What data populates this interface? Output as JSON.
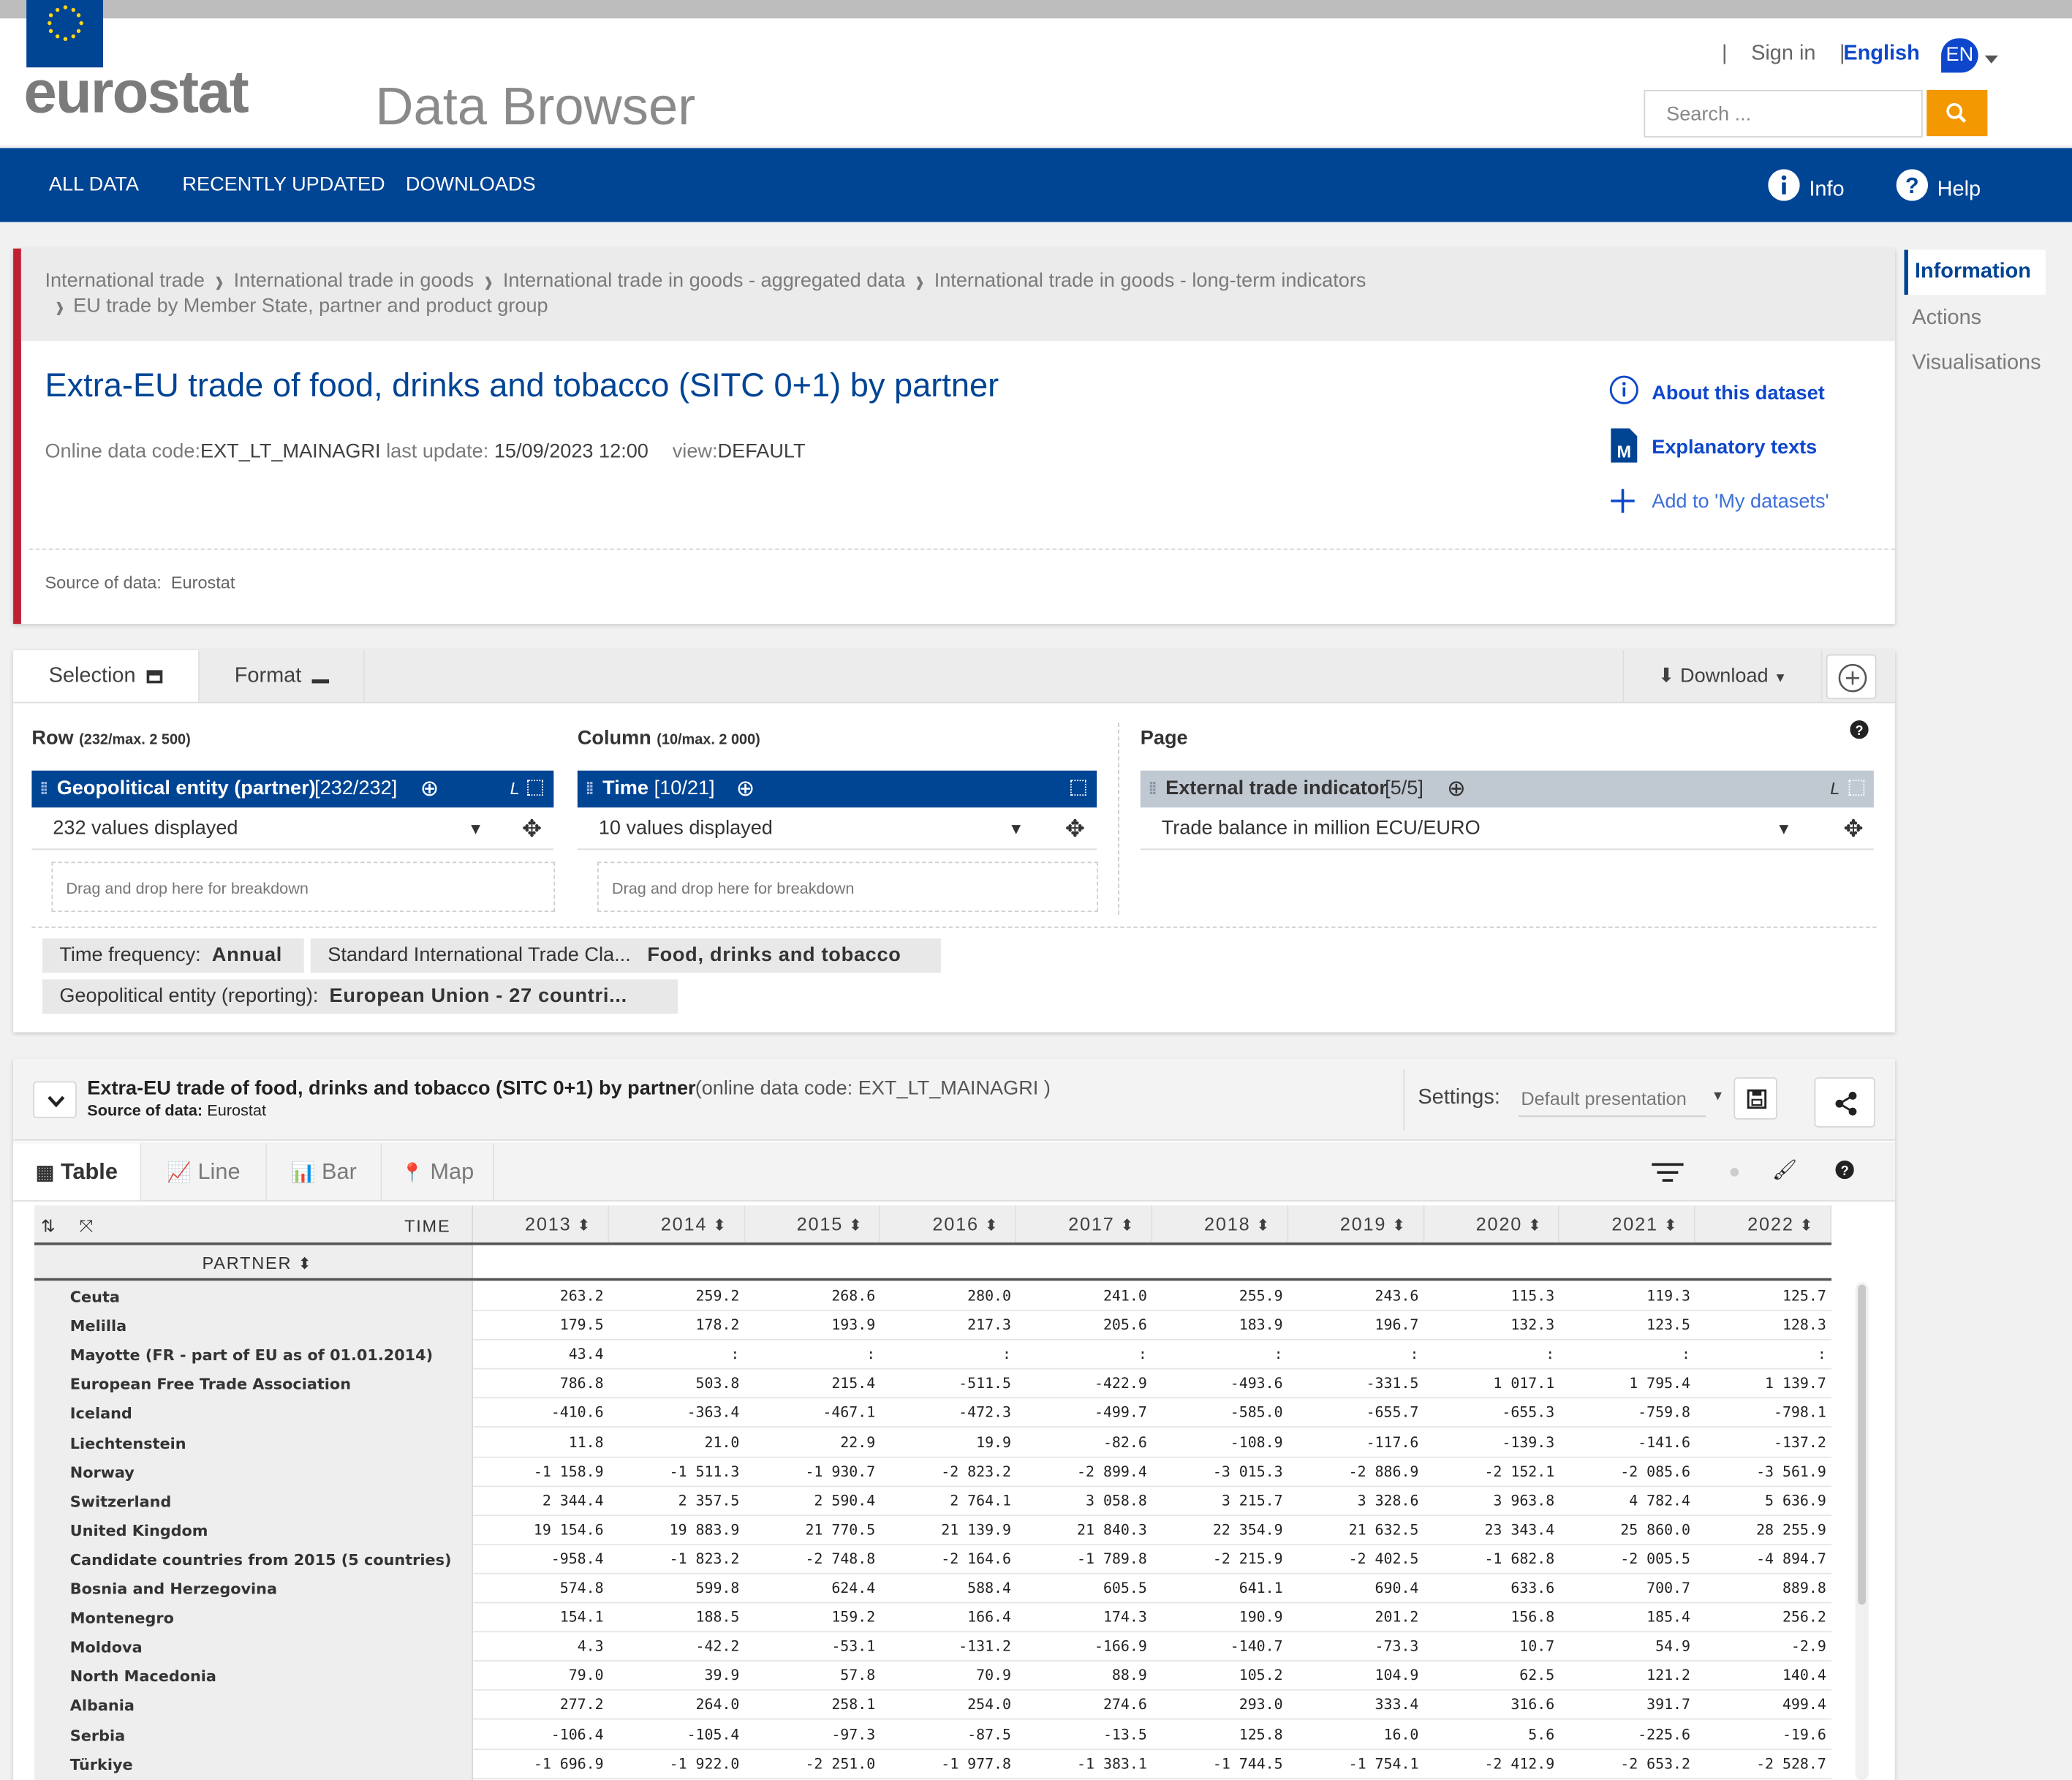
{
  "header": {
    "logo": "eurostat",
    "app_title": "Data Browser",
    "sign_in": "Sign in",
    "language": "English",
    "lang_code": "EN",
    "search_placeholder": "Search ...",
    "colors": {
      "brand": "#004494",
      "accent": "#f39800"
    }
  },
  "nav": {
    "items": [
      "ALL DATA",
      "RECENTLY UPDATED",
      "DOWNLOADS"
    ],
    "info": "Info",
    "help": "Help"
  },
  "breadcrumb": {
    "line1": [
      "International trade",
      "International trade in goods",
      "International trade in goods - aggregated data",
      "International trade in goods - long-term indicators"
    ],
    "line2": "EU trade by Member State, partner and product group"
  },
  "dataset": {
    "title": "Extra-EU trade of food, drinks and tobacco (SITC 0+1) by partner",
    "code_label": "Online data code:",
    "code": "EXT_LT_MAINAGRI",
    "update_label": "last update:",
    "update": "15/09/2023 12:00",
    "view_label": "view:",
    "view": "DEFAULT",
    "source_label": "Source of data:",
    "source": "Eurostat"
  },
  "dataset_links": {
    "about": "About this dataset",
    "explanatory": "Explanatory texts",
    "add": "Add to 'My datasets'"
  },
  "side_menu": {
    "items": [
      "Information",
      "Actions",
      "Visualisations"
    ],
    "active": "Information"
  },
  "selection": {
    "tab_selection": "Selection",
    "tab_format": "Format",
    "download": "Download",
    "row_label": "Row",
    "row_count": "(232/max. 2 500)",
    "col_label": "Column",
    "col_count": "(10/max. 2 000)",
    "page_label": "Page",
    "row_dim": "Geopolitical entity (partner)",
    "row_dim_count": "[232/232]",
    "row_values": "232 values displayed",
    "col_dim": "Time",
    "col_dim_count": "[10/21]",
    "col_values": "10 values displayed",
    "page_dim": "External trade indicator",
    "page_dim_count": "[5/5]",
    "page_value": "Trade balance in million ECU/EURO",
    "drag_hint": "Drag and drop here for breakdown",
    "l_marker": "L",
    "filters": [
      {
        "label": "Time frequency:",
        "value": "Annual"
      },
      {
        "label": "Standard International Trade Cla...",
        "value": "Food, drinks and tobacco"
      },
      {
        "label": "Geopolitical entity (reporting):",
        "value": "European Union - 27 countri..."
      }
    ]
  },
  "table_panel": {
    "title": "Extra-EU trade of food, drinks and tobacco (SITC 0+1) by partner",
    "code_note": "(online data code: EXT_LT_MAINAGRI )",
    "source_label": "Source of data:",
    "source": "Eurostat",
    "settings_label": "Settings:",
    "settings_value": "Default presentation",
    "view_tabs": [
      "Table",
      "Line",
      "Bar",
      "Map"
    ],
    "time_header": "TIME",
    "partner_header": "PARTNER",
    "years": [
      "2013",
      "2014",
      "2015",
      "2016",
      "2017",
      "2018",
      "2019",
      "2020",
      "2021",
      "2022"
    ],
    "rows": [
      {
        "partner": "Ceuta",
        "values": [
          "263.2",
          "259.2",
          "268.6",
          "280.0",
          "241.0",
          "255.9",
          "243.6",
          "115.3",
          "119.3",
          "125.7"
        ]
      },
      {
        "partner": "Melilla",
        "values": [
          "179.5",
          "178.2",
          "193.9",
          "217.3",
          "205.6",
          "183.9",
          "196.7",
          "132.3",
          "123.5",
          "128.3"
        ]
      },
      {
        "partner": "Mayotte (FR - part of EU as of 01.01.2014)",
        "values": [
          "43.4",
          ":",
          ":",
          ":",
          ":",
          ":",
          ":",
          ":",
          ":",
          ":"
        ]
      },
      {
        "partner": "European Free Trade Association",
        "values": [
          "786.8",
          "503.8",
          "215.4",
          "-511.5",
          "-422.9",
          "-493.6",
          "-331.5",
          "1 017.1",
          "1 795.4",
          "1 139.7"
        ]
      },
      {
        "partner": "Iceland",
        "values": [
          "-410.6",
          "-363.4",
          "-467.1",
          "-472.3",
          "-499.7",
          "-585.0",
          "-655.7",
          "-655.3",
          "-759.8",
          "-798.1"
        ]
      },
      {
        "partner": "Liechtenstein",
        "values": [
          "11.8",
          "21.0",
          "22.9",
          "19.9",
          "-82.6",
          "-108.9",
          "-117.6",
          "-139.3",
          "-141.6",
          "-137.2"
        ]
      },
      {
        "partner": "Norway",
        "values": [
          "-1 158.9",
          "-1 511.3",
          "-1 930.7",
          "-2 823.2",
          "-2 899.4",
          "-3 015.3",
          "-2 886.9",
          "-2 152.1",
          "-2 085.6",
          "-3 561.9"
        ]
      },
      {
        "partner": "Switzerland",
        "values": [
          "2 344.4",
          "2 357.5",
          "2 590.4",
          "2 764.1",
          "3 058.8",
          "3 215.7",
          "3 328.6",
          "3 963.8",
          "4 782.4",
          "5 636.9"
        ]
      },
      {
        "partner": "United Kingdom",
        "values": [
          "19 154.6",
          "19 883.9",
          "21 770.5",
          "21 139.9",
          "21 840.3",
          "22 354.9",
          "21 632.5",
          "23 343.4",
          "25 860.0",
          "28 255.9"
        ]
      },
      {
        "partner": "Candidate countries from 2015 (5 countries)",
        "values": [
          "-958.4",
          "-1 823.2",
          "-2 748.8",
          "-2 164.6",
          "-1 789.8",
          "-2 215.9",
          "-2 402.5",
          "-1 682.8",
          "-2 005.5",
          "-4 894.7"
        ]
      },
      {
        "partner": "Bosnia and Herzegovina",
        "values": [
          "574.8",
          "599.8",
          "624.4",
          "588.4",
          "605.5",
          "641.1",
          "690.4",
          "633.6",
          "700.7",
          "889.8"
        ]
      },
      {
        "partner": "Montenegro",
        "values": [
          "154.1",
          "188.5",
          "159.2",
          "166.4",
          "174.3",
          "190.9",
          "201.2",
          "156.8",
          "185.4",
          "256.2"
        ]
      },
      {
        "partner": "Moldova",
        "values": [
          "4.3",
          "-42.2",
          "-53.1",
          "-131.2",
          "-166.9",
          "-140.7",
          "-73.3",
          "10.7",
          "54.9",
          "-2.9"
        ]
      },
      {
        "partner": "North Macedonia",
        "values": [
          "79.0",
          "39.9",
          "57.8",
          "70.9",
          "88.9",
          "105.2",
          "104.9",
          "62.5",
          "121.2",
          "140.4"
        ]
      },
      {
        "partner": "Albania",
        "values": [
          "277.2",
          "264.0",
          "258.1",
          "254.0",
          "274.6",
          "293.0",
          "333.4",
          "316.6",
          "391.7",
          "499.4"
        ]
      },
      {
        "partner": "Serbia",
        "values": [
          "-106.4",
          "-105.4",
          "-97.3",
          "-87.5",
          "-13.5",
          "125.8",
          "16.0",
          "5.6",
          "-225.6",
          "-19.6"
        ]
      },
      {
        "partner": "Türkiye",
        "values": [
          "-1 696.9",
          "-1 922.0",
          "-2 251.0",
          "-1 977.8",
          "-1 383.1",
          "-1 744.5",
          "-1 754.1",
          "-2 412.9",
          "-2 653.2",
          "-2 528.7"
        ]
      }
    ]
  }
}
